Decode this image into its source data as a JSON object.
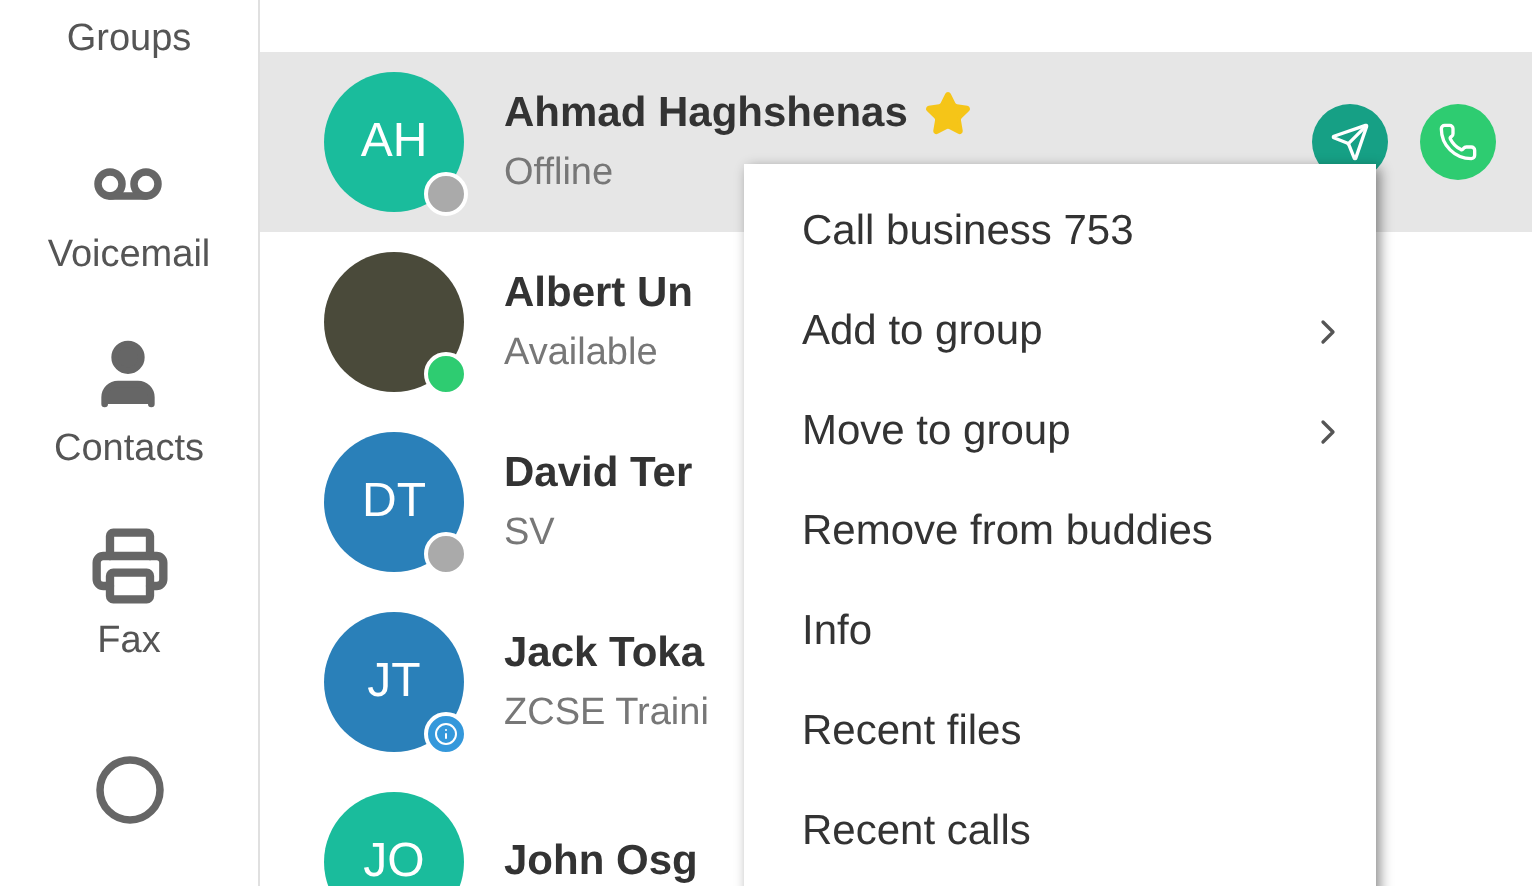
{
  "sidebar": {
    "items": [
      {
        "kind": "groups",
        "label": "Groups"
      },
      {
        "kind": "voicemail",
        "label": "Voicemail"
      },
      {
        "kind": "contacts",
        "label": "Contacts"
      },
      {
        "kind": "fax",
        "label": "Fax"
      },
      {
        "kind": "more"
      }
    ]
  },
  "contacts": [
    {
      "avatar": {
        "kind": "initials",
        "initials": "AH",
        "color": "#1abc9c"
      },
      "name": "Ahmad Haghshenas",
      "status": "Offline",
      "presence": {
        "kind": "dot",
        "color": "#aaaaaa"
      },
      "favorite": true,
      "selected": true
    },
    {
      "avatar": {
        "kind": "photo"
      },
      "name": "Albert Un",
      "status": "Available",
      "presence": {
        "kind": "dot",
        "color": "#2ecc71"
      },
      "favorite": false,
      "selected": false
    },
    {
      "avatar": {
        "kind": "initials",
        "initials": "DT",
        "color": "#2a80b9"
      },
      "name": "David Ter",
      "status": "SV",
      "presence": {
        "kind": "dot",
        "color": "#aaaaaa"
      },
      "favorite": false,
      "selected": false
    },
    {
      "avatar": {
        "kind": "initials",
        "initials": "JT",
        "color": "#2a80b9"
      },
      "name": "Jack Toka",
      "status": "ZCSE Traini",
      "presence": {
        "kind": "info",
        "color": "#3498db"
      },
      "favorite": false,
      "selected": false
    },
    {
      "avatar": {
        "kind": "initials",
        "initials": "JO",
        "color": "#1abc9c"
      },
      "name": "John Osg",
      "favorite": false,
      "selected": false
    }
  ],
  "context_menu": {
    "items": [
      {
        "label": "Call business 753",
        "submenu": false
      },
      {
        "label": "Add to group",
        "submenu": true
      },
      {
        "label": "Move to group",
        "submenu": true
      },
      {
        "label": "Remove from buddies",
        "submenu": false
      },
      {
        "label": "Info",
        "submenu": false
      },
      {
        "label": "Recent files",
        "submenu": false
      },
      {
        "label": "Recent calls",
        "submenu": false
      }
    ]
  }
}
